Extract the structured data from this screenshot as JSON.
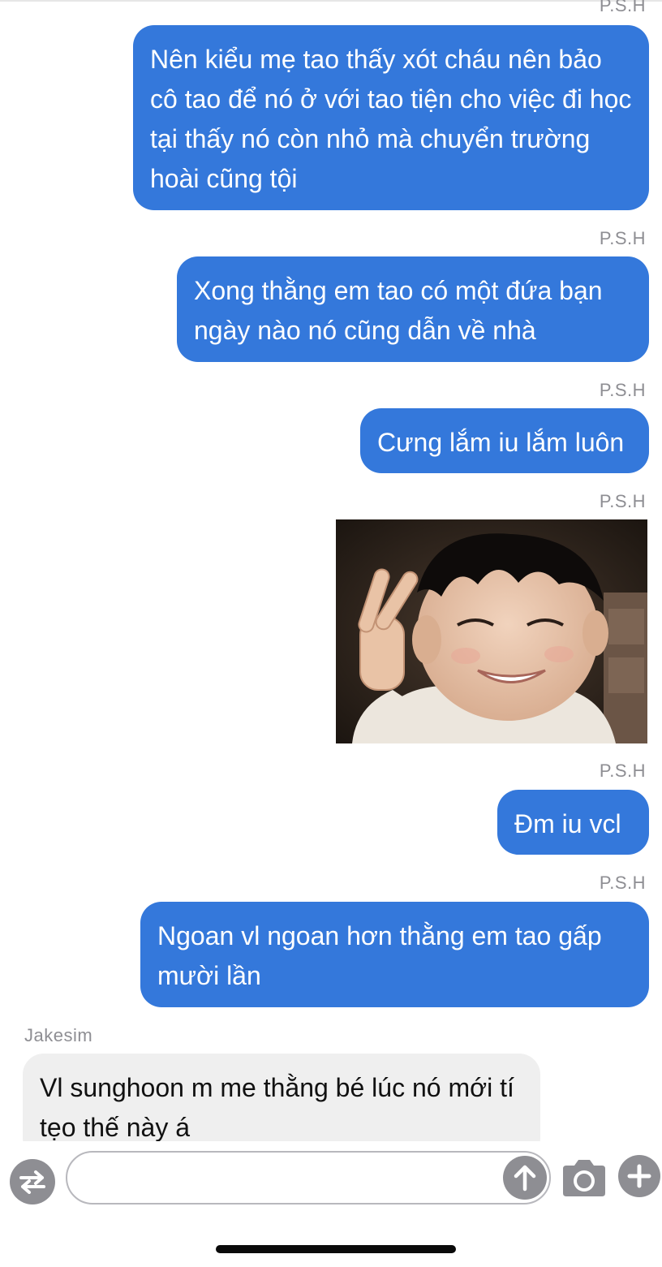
{
  "messages": [
    {
      "sender": "P.S.H",
      "text": "Nên kiểu mẹ tao thấy xót cháu nên bảo cô tao để nó ở với tao tiện cho việc đi học tại thấy nó còn nhỏ mà chuyển trường hoài cũng tội"
    },
    {
      "sender": "P.S.H",
      "text": "Xong thằng em tao có một đứa bạn ngày nào nó cũng dẫn về nhà"
    },
    {
      "sender": "P.S.H",
      "text": "Cưng lắm iu lắm luôn"
    },
    {
      "sender": "P.S.H",
      "image": "child-peace-sign-photo"
    },
    {
      "sender": "P.S.H",
      "text": "Đm iu vcl"
    },
    {
      "sender": "P.S.H",
      "text": "Ngoan vl ngoan hơn thằng em tao gấp mười lần"
    },
    {
      "sender": "Jakesim",
      "text": "Vl sunghoon m me thằng bé lúc nó mới tí tẹo thế này á"
    }
  ],
  "composer": {
    "value": "",
    "placeholder": ""
  },
  "icons": {
    "swap": "swap-arrows-icon",
    "send": "arrow-up-icon",
    "camera": "camera-icon",
    "plus": "plus-icon"
  },
  "colors": {
    "outgoing_bubble": "#3478db",
    "incoming_bubble": "#efefef",
    "icon_gray": "#8e8e93"
  }
}
